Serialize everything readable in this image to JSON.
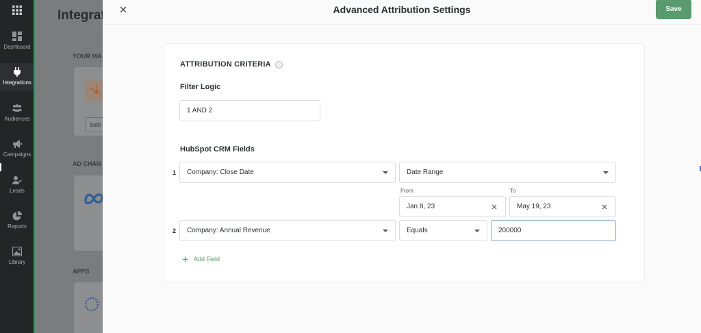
{
  "nav": {
    "items": [
      {
        "label": "Dashboard",
        "icon": "dashboard-icon"
      },
      {
        "label": "Integrations",
        "icon": "plug-icon",
        "active": true
      },
      {
        "label": "Audiences",
        "icon": "audiences-icon"
      },
      {
        "label": "Campaigns",
        "icon": "megaphone-icon"
      },
      {
        "label": "Leads",
        "icon": "leads-icon"
      },
      {
        "label": "Reports",
        "icon": "pie-chart-icon"
      },
      {
        "label": "Library",
        "icon": "image-icon"
      }
    ]
  },
  "background": {
    "title": "Integrat",
    "section_your": "YOUR MA",
    "section_ad": "AD CHAN",
    "section_apps": "APPS",
    "settings_button": "Setti"
  },
  "modal": {
    "title": "Advanced Attribution Settings",
    "save_label": "Save",
    "section_title": "ATTRIBUTION CRITERIA",
    "filter_logic_label": "Filter Logic",
    "filter_logic_value": "1 AND 2",
    "crm_fields_label": "HubSpot CRM Fields",
    "rows": [
      {
        "number": "1",
        "field": "Company: Close Date",
        "operator": "Date Range",
        "from_label": "From",
        "from_value": "Jan 8, 23",
        "to_label": "To",
        "to_value": "May 19, 23"
      },
      {
        "number": "2",
        "field": "Company: Annual Revenue",
        "operator": "Equals",
        "value": "200000"
      }
    ],
    "add_field_label": "Add Field"
  },
  "colors": {
    "accent_green": "#5a9a6f",
    "nav_bg": "#232527",
    "focus_border": "#8aa9c7"
  }
}
